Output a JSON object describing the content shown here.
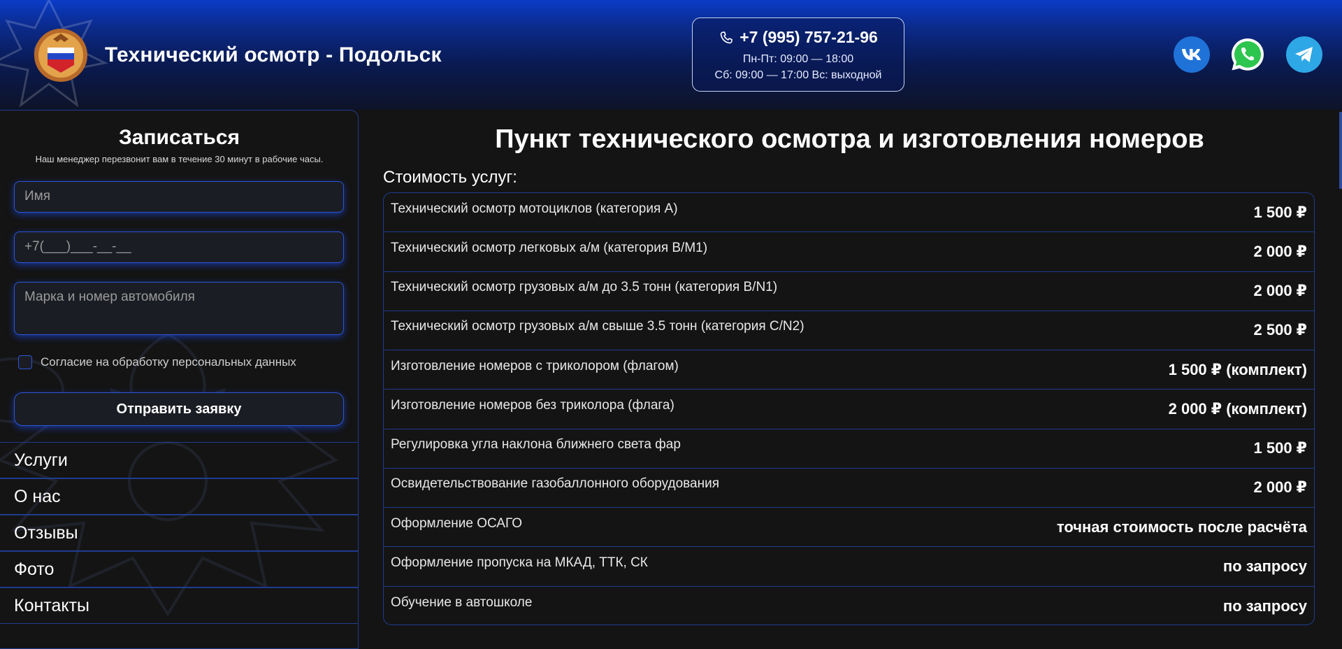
{
  "header": {
    "title": "Технический осмотр - Подольск",
    "phone": "+7 (995) 757-21-96",
    "hours_weekdays": "Пн-Пт: 09:00 — 18:00",
    "hours_weekend": "Сб: 09:00 — 17:00  Вс: выходной",
    "social": [
      "vk-icon",
      "whatsapp-icon",
      "telegram-icon"
    ]
  },
  "form": {
    "title": "Записаться",
    "subtitle": "Наш менеджер перезвонит вам в течение 30 минут в рабочие часы.",
    "name_placeholder": "Имя",
    "phone_placeholder": "+7(___)___-__-__",
    "car_placeholder": "Марка и номер автомобиля",
    "consent": "Согласие на обработку персональных данных",
    "submit": "Отправить заявку"
  },
  "nav": {
    "items": [
      {
        "label": "Услуги"
      },
      {
        "label": "О нас"
      },
      {
        "label": "Отзывы"
      },
      {
        "label": "Фото"
      },
      {
        "label": "Контакты"
      }
    ]
  },
  "main": {
    "title": "Пункт технического осмотра и изготовления номеров",
    "price_label": "Стоимость услуг:",
    "prices": [
      {
        "service": "Технический осмотр мотоциклов (категория А)",
        "price": "1 500 ₽"
      },
      {
        "service": "Технический осмотр легковых а/м (категория B/M1)",
        "price": "2 000 ₽"
      },
      {
        "service": "Технический осмотр грузовых а/м до 3.5 тонн (категория B/N1)",
        "price": "2 000 ₽"
      },
      {
        "service": "Технический осмотр грузовых а/м свыше 3.5 тонн (категория C/N2)",
        "price": "2 500 ₽"
      },
      {
        "service": "Изготовление номеров с триколором (флагом)",
        "price": "1 500 ₽ (комплект)"
      },
      {
        "service": "Изготовление номеров без триколора (флага)",
        "price": "2 000 ₽ (комплект)"
      },
      {
        "service": "Регулировка угла наклона ближнего света фар",
        "price": "1 500 ₽"
      },
      {
        "service": "Освидетельствование газобаллонного оборудования",
        "price": "2 000 ₽"
      },
      {
        "service": "Оформление ОСАГО",
        "price": "точная стоимость после расчёта"
      },
      {
        "service": "Оформление пропуска на МКАД, ТТК, СК",
        "price": "по запросу"
      },
      {
        "service": "Обучение в автошколе",
        "price": "по запросу"
      }
    ]
  },
  "colors": {
    "accent": "#2b56d8",
    "border": "#1f3c8f",
    "background": "#141414",
    "header_top": "#0a3cc8"
  }
}
